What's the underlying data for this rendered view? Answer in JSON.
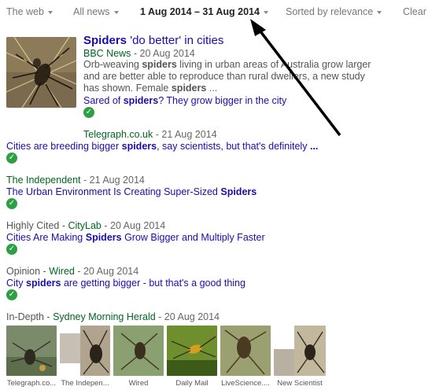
{
  "toolbar": {
    "web": "The web",
    "news": "All news",
    "date_range": "1 Aug 2014 – 31 Aug 2014",
    "sort": "Sorted by relevance",
    "clear": "Clear"
  },
  "main_result": {
    "title_bold": "Spiders",
    "title_rest": " 'do better' in cities",
    "source": "BBC News",
    "date": " - 20 Aug 2014",
    "snippet_1a": "Orb-weaving ",
    "snippet_1b": "spiders",
    "snippet_1c": " living in urban areas of Australia grow larger",
    "snippet_2": "and are better able to reproduce than rural dwellers, a new study",
    "snippet_3a": "has shown. Female ",
    "snippet_3b": "spiders",
    "snippet_3c": " ...",
    "related_a": "Sared of ",
    "related_b": "spiders",
    "related_c": "? They grow bigger in the city"
  },
  "results": [
    {
      "label": "",
      "source": "Telegraph.co.uk",
      "date": " - 21 Aug 2014",
      "title_a": "Cities are breeding bigger ",
      "title_b": "spiders",
      "title_c": ", say scientists, but that's definitely ",
      "title_d": "..."
    },
    {
      "label": "",
      "source": "The Independent",
      "date": " - 21 Aug 2014",
      "title_a": "The Urban Environment Is Creating Super-Sized ",
      "title_b": "Spiders",
      "title_c": "",
      "title_d": ""
    },
    {
      "label": "Highly Cited - ",
      "source": "CityLab",
      "date": " - 20 Aug 2014",
      "title_a": "Cities Are Making ",
      "title_b": "Spiders",
      "title_c": " Grow Bigger and Multiply Faster",
      "title_d": ""
    },
    {
      "label": "Opinion - ",
      "source": "Wired",
      "date": " - 20 Aug 2014",
      "title_a": "City ",
      "title_b": "spiders",
      "title_c": " are getting bigger - but that's a good thing",
      "title_d": ""
    }
  ],
  "in_depth": {
    "label": "In-Depth - ",
    "source": "Sydney Morning Herald",
    "date": " - 20 Aug 2014"
  },
  "thumbs": [
    "Telegraph.co...",
    "The Indepen...",
    "Wired",
    "Daily Mail",
    "LiveScience....",
    "New Scientist"
  ],
  "colors": {
    "link": "#1a0dab",
    "source": "#006621",
    "check": "#2ea043"
  },
  "icons": {
    "check": "check-circle-icon",
    "caret": "caret-down-icon",
    "annotation": "arrow-annotation"
  }
}
